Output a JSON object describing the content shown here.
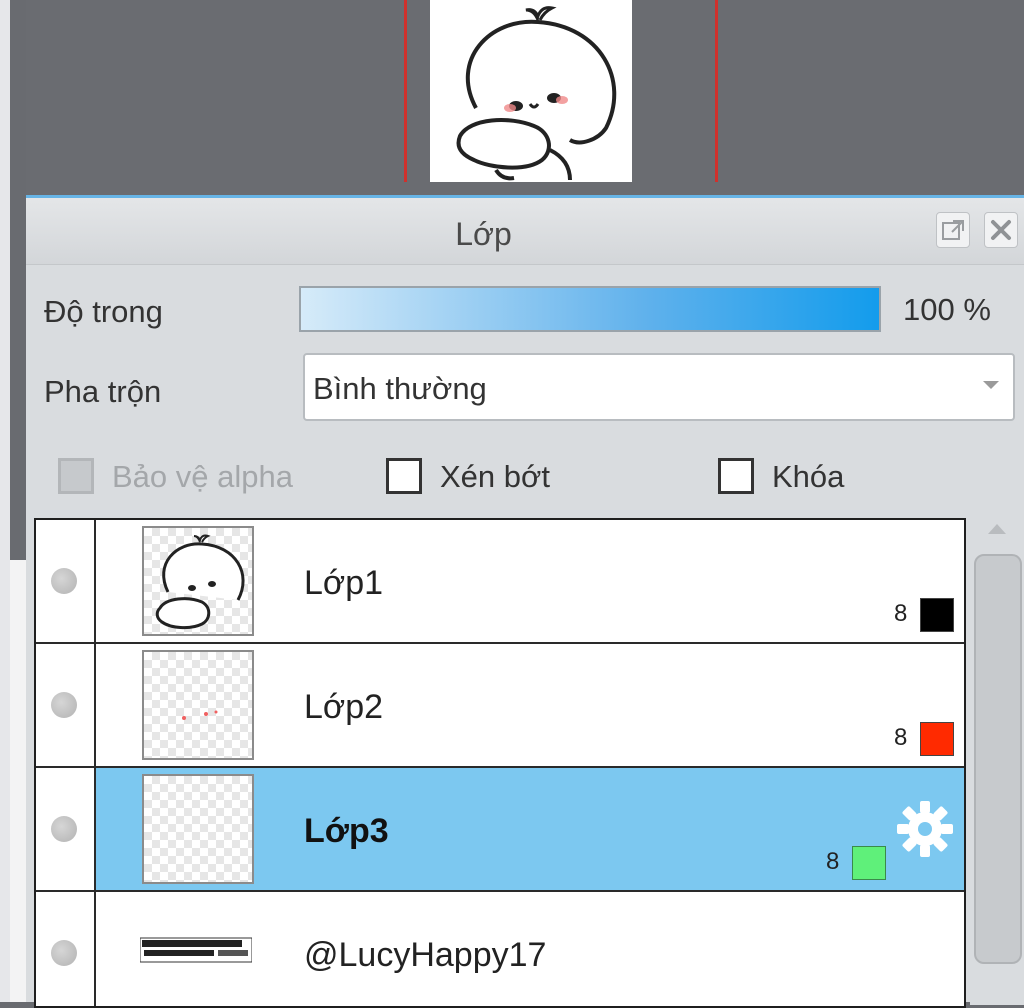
{
  "panel": {
    "title": "Lớp",
    "popout_icon": "popout-icon",
    "close_icon": "close-icon"
  },
  "opacity": {
    "label": "Độ trong",
    "value": "100 %",
    "level": 1.0
  },
  "blend": {
    "label": "Pha trộn",
    "selected": "Bình thường"
  },
  "options": {
    "protect_alpha": {
      "label": "Bảo vệ alpha",
      "checked": false,
      "enabled": false
    },
    "clip": {
      "label": "Xén bớt",
      "checked": false
    },
    "lock": {
      "label": "Khóa",
      "checked": false
    }
  },
  "layers": [
    {
      "name": "Lớp1",
      "color_num": "8",
      "color": "#000000",
      "selected": false
    },
    {
      "name": "Lớp2",
      "color_num": "8",
      "color": "#ff2a00",
      "selected": false
    },
    {
      "name": "Lớp3",
      "color_num": "8",
      "color": "#5ff07a",
      "selected": true,
      "icon": "gear-icon"
    },
    {
      "name": "@LucyHappy17",
      "selected": false
    }
  ],
  "colors": {
    "accent": "#66b4e6",
    "selection": "#7cc8f0",
    "frame_red": "#d0302c"
  }
}
